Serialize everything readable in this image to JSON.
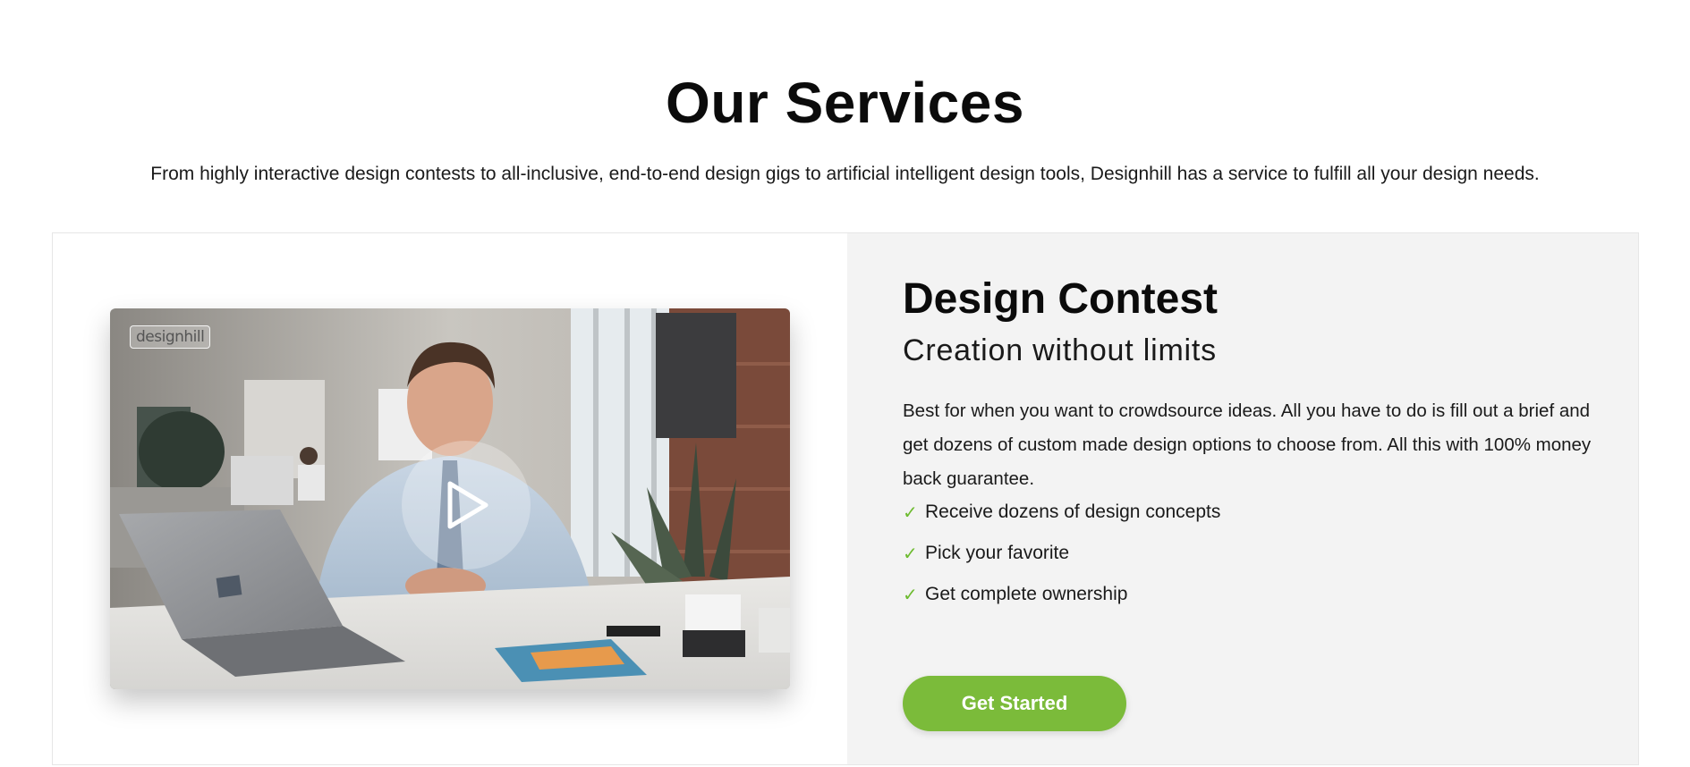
{
  "section": {
    "title": "Our Services",
    "subtitle": "From highly interactive design contests to all-inclusive, end-to-end design gigs to artificial intelligent design tools, Designhill has a service to fulfill all your design needs."
  },
  "video": {
    "logo_text": "designhill",
    "play_icon": "play-icon"
  },
  "contest": {
    "title": "Design Contest",
    "tagline": "Creation without limits",
    "description": "Best for when you want to crowdsource ideas. All you have to do is fill out a brief and get dozens of custom made design options to choose from. All this with 100% money back guarantee.",
    "features": [
      {
        "icon": "check-icon",
        "mark": "✓",
        "text": "Receive dozens of design concepts"
      },
      {
        "icon": "check-icon",
        "mark": "✓",
        "text": "Pick your favorite"
      },
      {
        "icon": "check-icon",
        "mark": "✓",
        "text": "Get complete ownership"
      }
    ],
    "cta_label": "Get Started"
  },
  "colors": {
    "accent_green": "#7bbb3a",
    "check_green": "#6dbb2f",
    "panel_bg": "#f3f3f3"
  }
}
